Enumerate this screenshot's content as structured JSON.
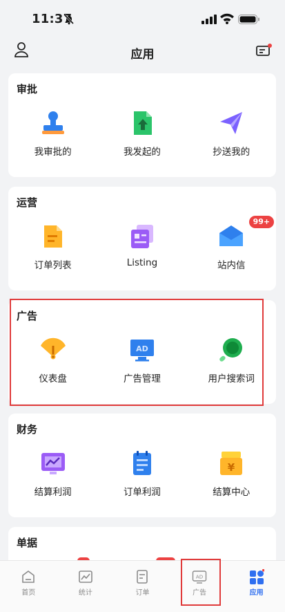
{
  "status": {
    "time": "11:37"
  },
  "header": {
    "title": "应用"
  },
  "sections": {
    "approval": {
      "title": "审批",
      "items": [
        {
          "label": "我审批的",
          "icon": "stamp-icon"
        },
        {
          "label": "我发起的",
          "icon": "document-upload-icon"
        },
        {
          "label": "抄送我的",
          "icon": "paper-plane-icon"
        }
      ]
    },
    "operations": {
      "title": "运营",
      "items": [
        {
          "label": "订单列表",
          "icon": "order-list-icon"
        },
        {
          "label": "Listing",
          "icon": "listing-icon"
        },
        {
          "label": "站内信",
          "icon": "mail-icon",
          "badge": "99+"
        }
      ]
    },
    "ads": {
      "title": "广告",
      "items": [
        {
          "label": "仪表盘",
          "icon": "dashboard-icon"
        },
        {
          "label": "广告管理",
          "icon": "ad-monitor-icon"
        },
        {
          "label": "用户搜索词",
          "icon": "search-icon"
        }
      ]
    },
    "finance": {
      "title": "财务",
      "items": [
        {
          "label": "结算利润",
          "icon": "chart-monitor-icon"
        },
        {
          "label": "订单利润",
          "icon": "calendar-sheet-icon"
        },
        {
          "label": "结算中心",
          "icon": "yen-box-icon"
        }
      ]
    },
    "documents": {
      "title": "单据"
    }
  },
  "tabbar": [
    {
      "label": "首页",
      "icon": "home-icon"
    },
    {
      "label": "统计",
      "icon": "stats-icon"
    },
    {
      "label": "订单",
      "icon": "order-icon"
    },
    {
      "label": "广告",
      "icon": "ad-icon"
    },
    {
      "label": "应用",
      "icon": "apps-grid-icon",
      "active": true
    }
  ],
  "colors": {
    "accent": "#2f6ff0",
    "badge": "#ec4242",
    "highlight": "#e03a3a"
  }
}
